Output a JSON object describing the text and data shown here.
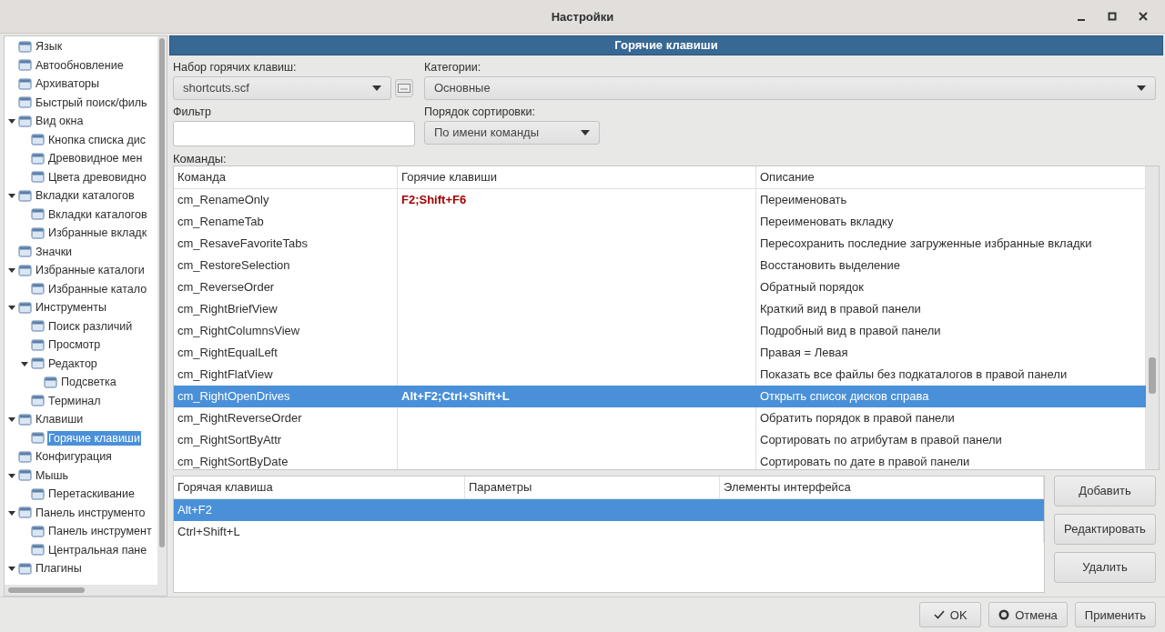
{
  "window": {
    "title": "Настройки"
  },
  "sidebar": {
    "items": [
      {
        "label": "Язык"
      },
      {
        "label": "Автообновление"
      },
      {
        "label": "Архиваторы"
      },
      {
        "label": "Быстрый поиск/филь"
      },
      {
        "label": "Вид окна",
        "expanded": true,
        "children": [
          {
            "label": "Кнопка списка дис"
          },
          {
            "label": "Древовидное мен"
          },
          {
            "label": "Цвета древовидно"
          }
        ]
      },
      {
        "label": "Вкладки каталогов",
        "expanded": true,
        "children": [
          {
            "label": "Вкладки каталогов"
          },
          {
            "label": "Избранные вкладк"
          }
        ]
      },
      {
        "label": "Значки"
      },
      {
        "label": "Избранные каталоги",
        "expanded": true,
        "children": [
          {
            "label": "Избранные катало"
          }
        ]
      },
      {
        "label": "Инструменты",
        "expanded": true,
        "children": [
          {
            "label": "Поиск различий"
          },
          {
            "label": "Просмотр"
          },
          {
            "label": "Редактор",
            "expanded": true,
            "children": [
              {
                "label": "Подсветка"
              }
            ]
          },
          {
            "label": "Терминал"
          }
        ]
      },
      {
        "label": "Клавиши",
        "expanded": true,
        "children": [
          {
            "label": "Горячие клавиши",
            "selected": true
          }
        ]
      },
      {
        "label": "Конфигурация"
      },
      {
        "label": "Мышь",
        "expanded": true,
        "children": [
          {
            "label": "Перетаскивание"
          }
        ]
      },
      {
        "label": "Панель инструменто",
        "expanded": true,
        "children": [
          {
            "label": "Панель инструмент"
          },
          {
            "label": "Центральная пане"
          }
        ]
      },
      {
        "label": "Плагины",
        "expanded": true
      }
    ]
  },
  "header": "Горячие клавиши",
  "shortcut_set": {
    "label": "Набор горячих клавиш:",
    "value": "shortcuts.scf"
  },
  "categories": {
    "label": "Категории:",
    "value": "Основные"
  },
  "filter": {
    "label": "Фильтр"
  },
  "sort_order": {
    "label": "Порядок сортировки:",
    "value": "По имени команды"
  },
  "commands": {
    "label": "Команды:",
    "columns": [
      "Команда",
      "Горячие клавиши",
      "Описание"
    ],
    "rows": [
      {
        "command": "cm_RenameOnly",
        "keys": "F2;Shift+F6",
        "description": "Переименовать",
        "selected": false,
        "highlighted": true
      },
      {
        "command": "cm_RenameTab",
        "description": "Переименовать вкладку",
        "selected": false
      },
      {
        "command": "cm_ResaveFavoriteTabs",
        "description": "Пересохранить последние загруженные избранные вкладки",
        "selected": false
      },
      {
        "command": "cm_RestoreSelection",
        "description": "Восстановить выделение",
        "selected": false
      },
      {
        "command": "cm_ReverseOrder",
        "description": "Обратный порядок",
        "selected": false
      },
      {
        "command": "cm_RightBriefView",
        "description": "Краткий вид в правой панели",
        "selected": false
      },
      {
        "command": "cm_RightColumnsView",
        "description": "Подробный вид в правой панели",
        "selected": false
      },
      {
        "command": "cm_RightEqualLeft",
        "description": "Правая = Левая",
        "selected": false
      },
      {
        "command": "cm_RightFlatView",
        "description": "Показать все файлы без подкаталогов в правой панели",
        "selected": false
      },
      {
        "command": "cm_RightOpenDrives",
        "keys": "Alt+F2;Ctrl+Shift+L",
        "description": "Открыть список дисков справа",
        "selected": true
      },
      {
        "command": "cm_RightReverseOrder",
        "description": "Обратить порядок в правой панели",
        "selected": false
      },
      {
        "command": "cm_RightSortByAttr",
        "description": "Сортировать по атрибутам в правой панели",
        "selected": false
      },
      {
        "command": "cm_RightSortByDate",
        "description": "Сортировать по дате в правой панели",
        "selected": false
      }
    ]
  },
  "hotkeys": {
    "columns": [
      "Горячая клавиша",
      "Параметры",
      "Элементы интерфейса"
    ],
    "rows": [
      {
        "key": "Alt+F2",
        "selected": true
      },
      {
        "key": "Ctrl+Shift+L",
        "selected": false
      }
    ]
  },
  "side_buttons": [
    "Добавить",
    "Редактировать",
    "Удалить"
  ],
  "footer_buttons": [
    {
      "label": "OK",
      "kind": "ok"
    },
    {
      "label": "Отмена",
      "kind": "cancel"
    },
    {
      "label": "Применить",
      "kind": "plain"
    }
  ]
}
